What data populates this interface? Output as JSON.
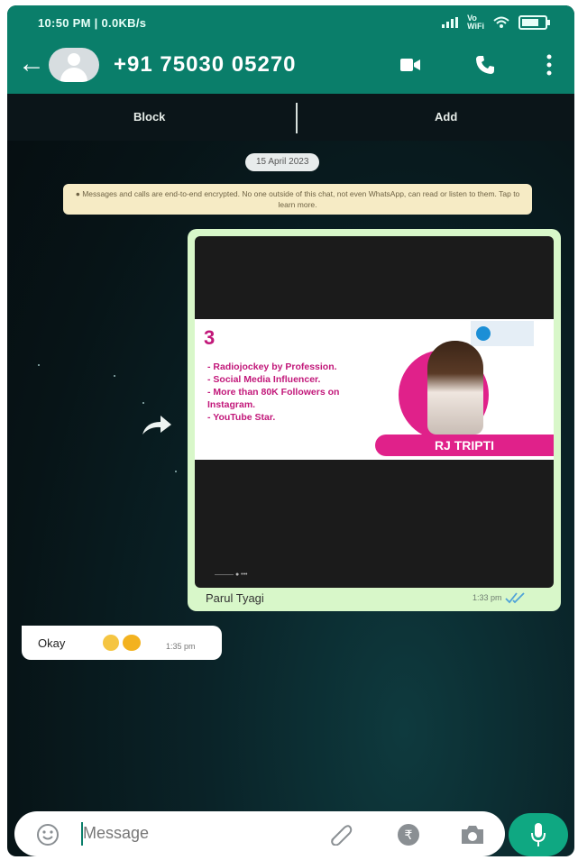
{
  "status_bar": {
    "left_text": "10:50 PM | 0.0KB/s",
    "network_label_top": "Vo",
    "network_label_bottom": "WiFi"
  },
  "header": {
    "back_icon": "arrow-left-icon",
    "contact_name": "+91 75030 05270",
    "icons": [
      "video-call-icon",
      "voice-call-icon",
      "more-vertical-icon"
    ]
  },
  "action_bar": {
    "block_label": "Block",
    "add_label": "Add"
  },
  "chat": {
    "date": "15 April 2023",
    "encryption_notice": "Messages and calls are end-to-end encrypted. No one outside of this chat, not even WhatsApp, can read or listen to them. Tap to learn more.",
    "outgoing": {
      "poster": {
        "logo_text": "3",
        "lines": [
          "- Radiojockey by Profession.",
          "- Social Media Influencer.",
          "- More than 80K Followers on",
          "  Instagram.",
          "- YouTube Star."
        ],
        "name_band": "RJ TRIPTI"
      },
      "sender": "Parul Tyagi",
      "time": "1:33 pm"
    },
    "incoming": {
      "text": "Okay",
      "time": "1:35 pm"
    }
  },
  "composer": {
    "placeholder": "Message",
    "icons": [
      "emoji-icon",
      "attach-icon",
      "rupee-icon",
      "camera-icon",
      "mic-icon"
    ]
  },
  "colors": {
    "header_green": "#0a7e6a",
    "outgoing_bubble": "#d8f7c9",
    "accent_pink": "#e0218a",
    "mic_green": "#0fa882"
  }
}
